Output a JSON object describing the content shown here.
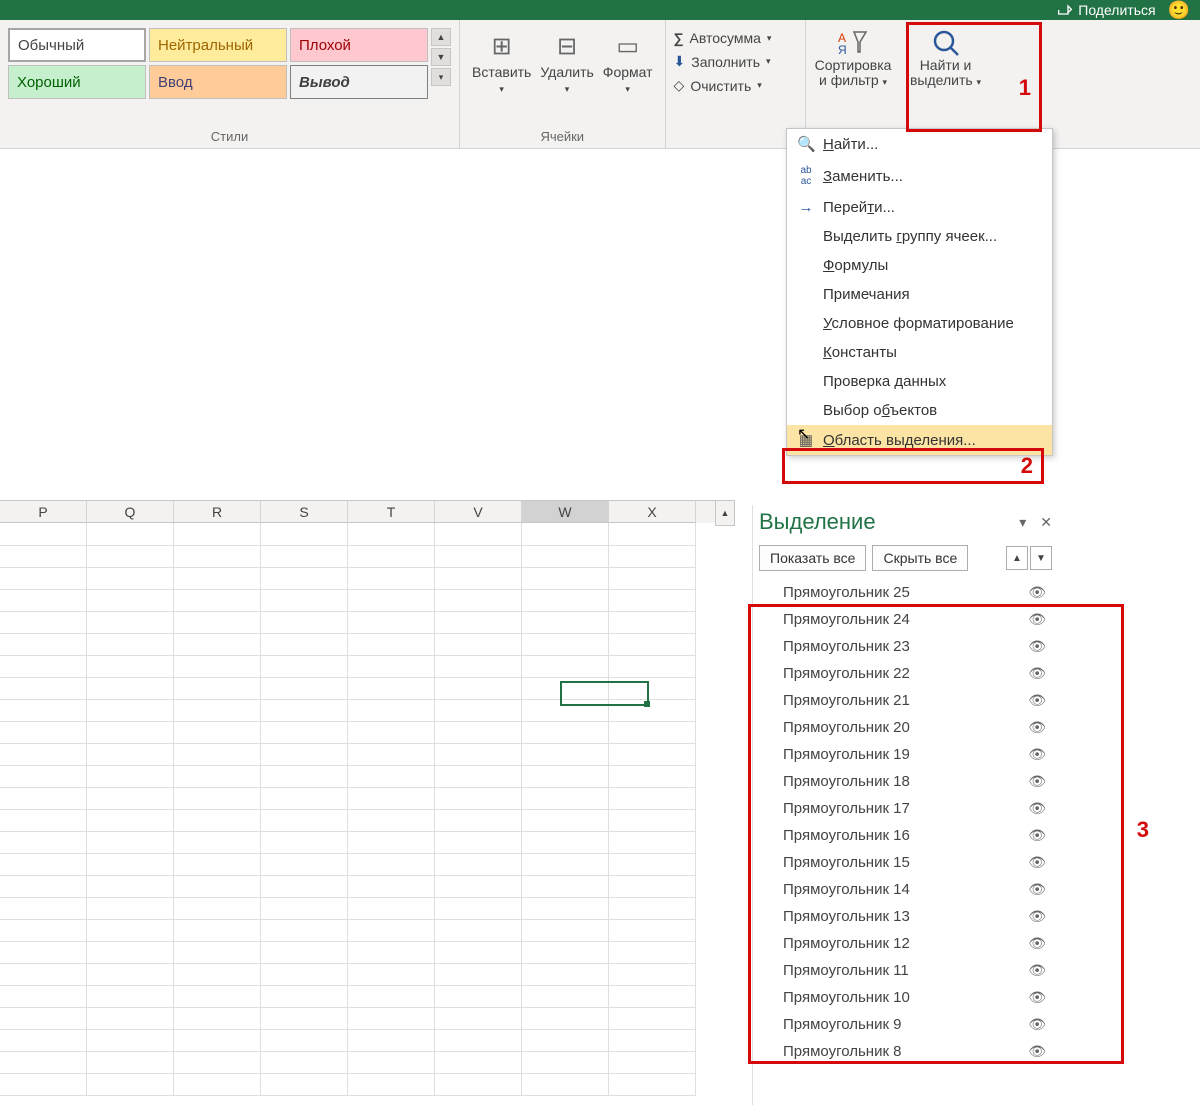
{
  "titlebar": {
    "share": "Поделиться"
  },
  "ribbon": {
    "styles": {
      "normal": "Обычный",
      "neutral": "Нейтральный",
      "bad": "Плохой",
      "good": "Хороший",
      "input": "Ввод",
      "output": "Вывод",
      "group_label": "Стили"
    },
    "cells": {
      "insert": "Вставить",
      "delete": "Удалить",
      "format": "Формат",
      "group_label": "Ячейки"
    },
    "editing": {
      "autosum": "Автосумма",
      "fill": "Заполнить",
      "clear": "Очистить",
      "sort_filter_line1": "Сортировка",
      "sort_filter_line2": "и фильтр",
      "find_select_line1": "Найти и",
      "find_select_line2": "выделить"
    }
  },
  "dropdown": {
    "find": "Найти...",
    "replace": "Заменить...",
    "goto": "Перейти...",
    "goto_special": "Выделить группу ячеек...",
    "formulas": "Формулы",
    "comments": "Примечания",
    "conditional": "Условное форматирование",
    "constants": "Константы",
    "validation": "Проверка данных",
    "select_objects": "Выбор объектов",
    "selection_pane": "Область выделения..."
  },
  "callouts": {
    "c1": "1",
    "c2": "2",
    "c3": "3"
  },
  "sheet": {
    "columns": [
      "P",
      "Q",
      "R",
      "S",
      "T",
      "V",
      "W",
      "X"
    ]
  },
  "selection_pane": {
    "title": "Выделение",
    "show_all": "Показать все",
    "hide_all": "Скрыть все",
    "items": [
      "Прямоугольник 25",
      "Прямоугольник 24",
      "Прямоугольник 23",
      "Прямоугольник 22",
      "Прямоугольник 21",
      "Прямоугольник 20",
      "Прямоугольник 19",
      "Прямоугольник 18",
      "Прямоугольник 17",
      "Прямоугольник 16",
      "Прямоугольник 15",
      "Прямоугольник 14",
      "Прямоугольник 13",
      "Прямоугольник 12",
      "Прямоугольник 11",
      "Прямоугольник 10",
      "Прямоугольник 9",
      "Прямоугольник 8"
    ]
  }
}
